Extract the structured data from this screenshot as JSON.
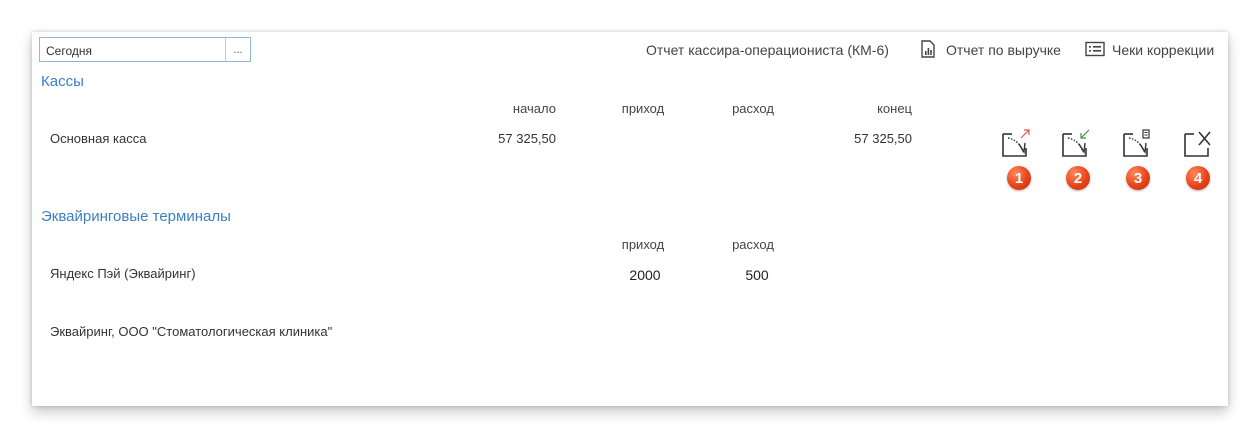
{
  "period": {
    "value": "Сегодня",
    "select_button": "..."
  },
  "toolbar": {
    "km6_report": "Отчет кассира-операциониста (КМ-6)",
    "revenue_report": "Отчет по выручке",
    "correction_receipts": "Чеки коррекции"
  },
  "cash_registers": {
    "title": "Кассы",
    "headers": {
      "start": "начало",
      "income": "приход",
      "expense": "расход",
      "end": "конец"
    },
    "rows": [
      {
        "name": "Основная касса",
        "start": "57 325,50",
        "income": "",
        "expense": "",
        "end": "57 325,50"
      }
    ],
    "badges": [
      "1",
      "2",
      "3",
      "4"
    ]
  },
  "terminals": {
    "title": "Эквайринговые терминалы",
    "headers": {
      "income": "приход",
      "expense": "расход"
    },
    "rows": [
      {
        "name": "Яндекс Пэй (Эквайринг)",
        "income": "2000",
        "expense": "500"
      },
      {
        "name": "Эквайринг, ООО \"Стоматологическая клиника\"",
        "income": "",
        "expense": ""
      }
    ]
  },
  "colors": {
    "accent": "#3d7fc4",
    "badge": "#e8431a",
    "field_border": "#8fb6dd"
  }
}
